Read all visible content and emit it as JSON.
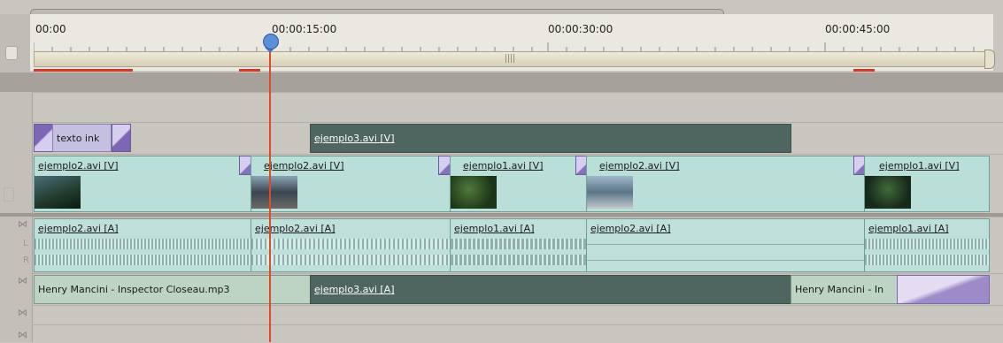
{
  "ruler": {
    "timecodes": [
      "00:00",
      "00:00:15:00",
      "00:00:30:00",
      "00:00:45:00"
    ]
  },
  "tracks": {
    "video2": {
      "clips": [
        {
          "label": "texto ink"
        },
        {
          "label": "ejemplo3.avi [V]"
        }
      ]
    },
    "video1": {
      "clips": [
        {
          "label": "ejemplo2.avi [V]"
        },
        {
          "label": "ejemplo2.avi [V]"
        },
        {
          "label": "ejemplo1.avi [V]"
        },
        {
          "label": "ejemplo2.avi [V]"
        },
        {
          "label": "ejemplo1.avi [V]"
        }
      ]
    },
    "audio1": {
      "channel_left": "L",
      "channel_right": "R",
      "clips": [
        {
          "label": "ejemplo2.avi [A]"
        },
        {
          "label": "ejemplo2.avi [A]"
        },
        {
          "label": "ejemplo1.avi [A]"
        },
        {
          "label": "ejemplo2.avi [A]"
        },
        {
          "label": "ejemplo1.avi [A]"
        }
      ]
    },
    "audio2": {
      "clips": [
        {
          "label": "Henry Mancini - Inspector Closeau.mp3"
        },
        {
          "label": "ejemplo3.avi [A]"
        },
        {
          "label": "Henry Mancini - In"
        }
      ]
    }
  },
  "colors": {
    "playhead": "#e0492e",
    "video_clip": "#b9dfd8",
    "dark_clip": "#4f6660",
    "transition": "#7d67b5"
  }
}
